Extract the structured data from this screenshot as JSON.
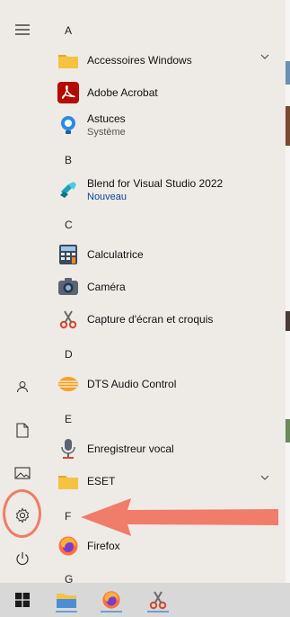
{
  "menu": {
    "sections": [
      {
        "letter": "A"
      },
      {
        "letter": "B"
      },
      {
        "letter": "C"
      },
      {
        "letter": "D"
      },
      {
        "letter": "E"
      },
      {
        "letter": "F"
      },
      {
        "letter": "G"
      }
    ],
    "apps": [
      {
        "name": "Accessoires Windows",
        "icon": "folder-icon",
        "expandable": true
      },
      {
        "name": "Adobe Acrobat",
        "icon": "acrobat-icon"
      },
      {
        "name": "Astuces",
        "subtitle": "Système",
        "icon": "tips-icon"
      },
      {
        "name": "Blend for Visual Studio 2022",
        "subtitle": "Nouveau",
        "icon": "blend-icon"
      },
      {
        "name": "Calculatrice",
        "icon": "calculator-icon"
      },
      {
        "name": "Caméra",
        "icon": "camera-icon"
      },
      {
        "name": "Capture d'écran et croquis",
        "icon": "snip-icon"
      },
      {
        "name": "DTS Audio Control",
        "icon": "dts-icon"
      },
      {
        "name": "Enregistreur vocal",
        "icon": "microphone-icon"
      },
      {
        "name": "ESET",
        "icon": "folder-icon",
        "expandable": true
      },
      {
        "name": "Firefox",
        "icon": "firefox-icon"
      }
    ]
  },
  "rail": [
    "hamburger-icon",
    "user-icon",
    "document-icon",
    "pictures-icon",
    "settings-icon",
    "power-icon"
  ],
  "taskbar": [
    "windows-logo-icon",
    "file-explorer-icon",
    "firefox-icon",
    "snip-icon"
  ],
  "colors": {
    "annotation": "#f07c6a",
    "accent": "#0a4a8c",
    "folder": "#f5c242"
  }
}
